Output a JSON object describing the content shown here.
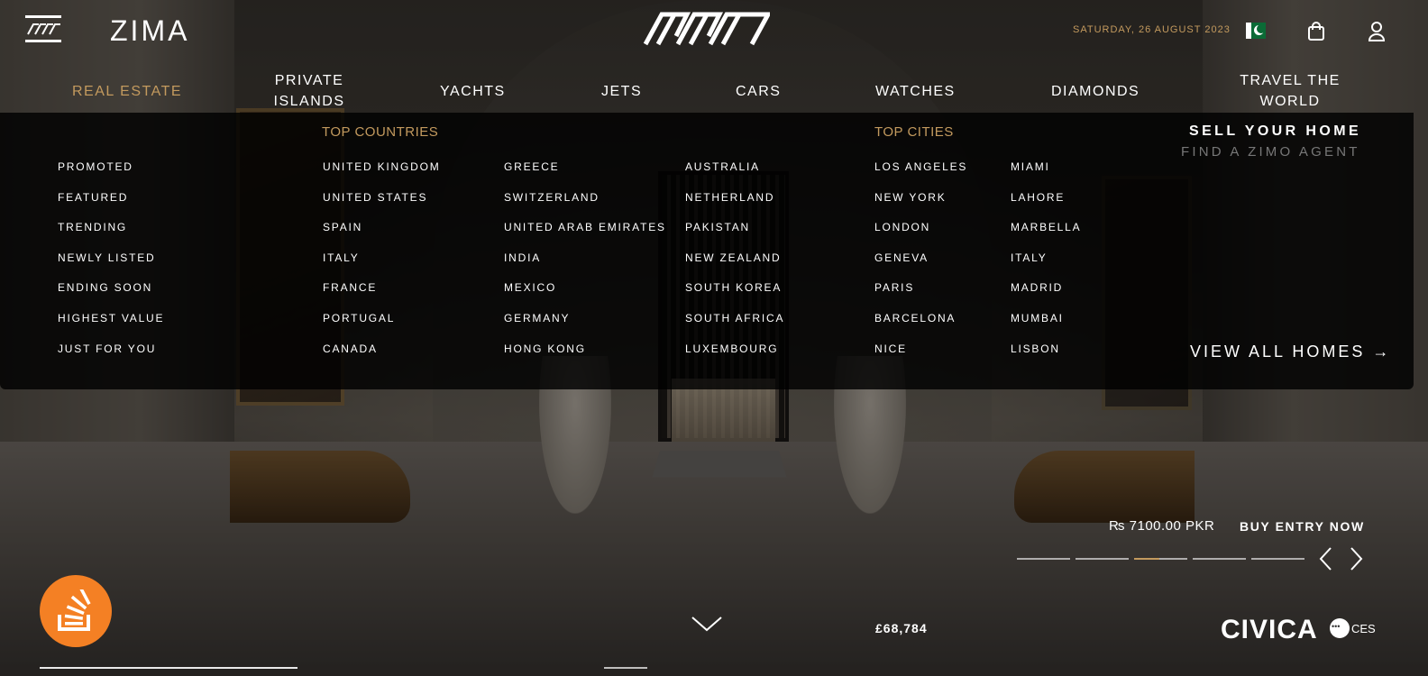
{
  "header": {
    "brand": "ZIMA",
    "date": "SATURDAY, 26 AUGUST 2023"
  },
  "nav": [
    {
      "label": "REAL ESTATE",
      "active": true
    },
    {
      "label": "PRIVATE ISLANDS"
    },
    {
      "label": "YACHTS"
    },
    {
      "label": "JETS"
    },
    {
      "label": "CARS"
    },
    {
      "label": "WATCHES"
    },
    {
      "label": "DIAMONDS"
    },
    {
      "label": "TRAVEL THE WORLD"
    }
  ],
  "mega": {
    "categories": [
      "PROMOTED",
      "FEATURED",
      "TRENDING",
      "NEWLY LISTED",
      "ENDING SOON",
      "HIGHEST VALUE",
      "JUST FOR YOU"
    ],
    "top_countries_title": "TOP COUNTRIES",
    "countries_col1": [
      "UNITED KINGDOM",
      "UNITED STATES",
      "SPAIN",
      "ITALY",
      "FRANCE",
      "PORTUGAL",
      "CANADA"
    ],
    "countries_col2": [
      "GREECE",
      "SWITZERLAND",
      "UNITED ARAB EMIRATES",
      "INDIA",
      "MEXICO",
      "GERMANY",
      "HONG KONG"
    ],
    "countries_col3": [
      "AUSTRALIA",
      "NETHERLAND",
      "PAKISTAN",
      "NEW ZEALAND",
      "SOUTH KOREA",
      "SOUTH AFRICA",
      "LUXEMBOURG"
    ],
    "top_cities_title": "TOP CITIES",
    "cities_col1": [
      "LOS ANGELES",
      "NEW YORK",
      "LONDON",
      "GENEVA",
      "PARIS",
      "BARCELONA",
      "NICE"
    ],
    "cities_col2": [
      "MIAMI",
      "LAHORE",
      "MARBELLA",
      "ITALY",
      "MADRID",
      "MUMBAI",
      "LISBON"
    ],
    "sell_home": "SELL YOUR HOME",
    "find_agent": "FIND A ZIMO AGENT",
    "view_all": "VIEW ALL HOMES"
  },
  "hero": {
    "price": "₨ 7100.00 PKR",
    "buy_label": "BUY ENTRY NOW",
    "slide_count": 5,
    "active_slide": 3,
    "gbp_value": "£68,784",
    "partner_1": "CIVICA",
    "partner_2": "CES"
  },
  "colors": {
    "accent": "#c39a5e",
    "stackoverflow": "#f48024",
    "flag_green": "#0b6b36"
  },
  "icons": [
    "hamburger-menu-icon",
    "logo-mark-icon",
    "pakistan-flag-icon",
    "shopping-bag-icon",
    "user-icon",
    "arrow-right-icon",
    "chevron-left-icon",
    "chevron-right-icon",
    "chevron-down-icon",
    "stackoverflow-icon"
  ]
}
